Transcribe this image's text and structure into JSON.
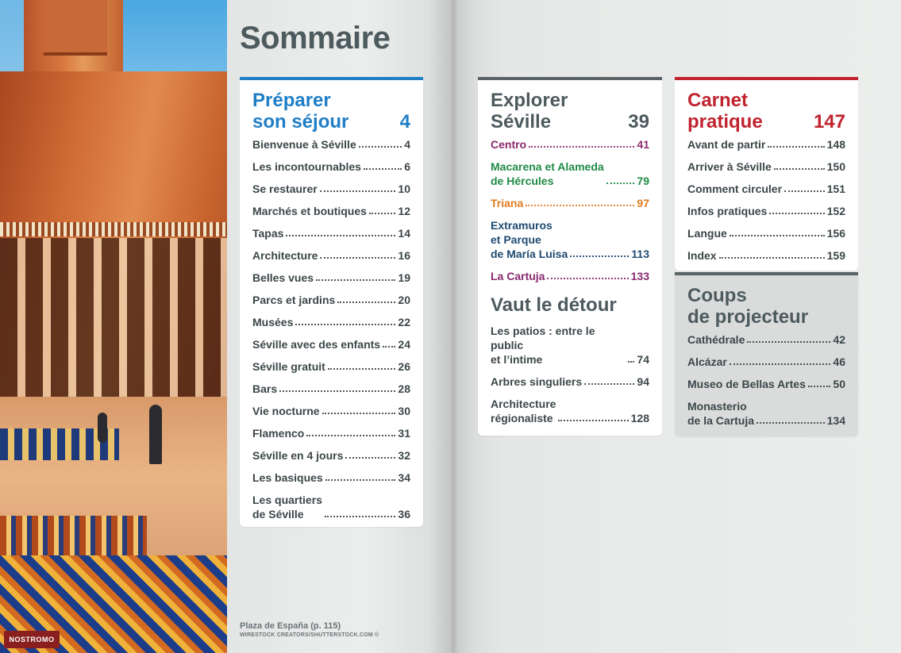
{
  "title": "Sommaire",
  "colors": {
    "blue": "#1f7ec6",
    "gray": "#4d5a5e",
    "red": "#c0232e",
    "purple": "#8a2a6e",
    "green": "#1f8a45",
    "orange": "#e07a1f",
    "navy": "#1f4a72"
  },
  "preparer": {
    "heading": "Préparer\nson séjour",
    "page": "4",
    "entries": [
      {
        "label": "Bienvenue à Séville",
        "page": "4"
      },
      {
        "label": "Les incontournables",
        "page": "6"
      },
      {
        "label": "Se restaurer",
        "page": "10"
      },
      {
        "label": "Marchés et boutiques",
        "page": "12"
      },
      {
        "label": "Tapas",
        "page": "14"
      },
      {
        "label": "Architecture",
        "page": "16"
      },
      {
        "label": "Belles vues",
        "page": "19"
      },
      {
        "label": "Parcs et jardins",
        "page": "20"
      },
      {
        "label": "Musées",
        "page": "22"
      },
      {
        "label": "Séville avec des enfants",
        "page": "24"
      },
      {
        "label": "Séville gratuit",
        "page": "26"
      },
      {
        "label": "Bars",
        "page": "28"
      },
      {
        "label": "Vie nocturne",
        "page": "30"
      },
      {
        "label": "Flamenco",
        "page": "31"
      },
      {
        "label": "Séville en 4 jours",
        "page": "32"
      },
      {
        "label": "Les basiques",
        "page": "34"
      },
      {
        "label": "Les quartiers\nde Séville",
        "page": "36"
      }
    ]
  },
  "explorer": {
    "heading": "Explorer\nSéville",
    "page": "39",
    "entries": [
      {
        "label": "Centro",
        "page": "41",
        "color": "#8a2a6e"
      },
      {
        "label": "Macarena et Alameda\nde Hércules",
        "page": "79",
        "color": "#1f8a45"
      },
      {
        "label": "Triana",
        "page": "97",
        "color": "#e07a1f"
      },
      {
        "label": "Extramuros\net Parque\nde María Luisa",
        "page": "113",
        "color": "#1f4a72"
      },
      {
        "label": "La Cartuja",
        "page": "133",
        "color": "#8a2a6e"
      }
    ]
  },
  "detour": {
    "heading": "Vaut le détour",
    "entries": [
      {
        "label": "Les patios : entre le public\net l’intime",
        "page": "74"
      },
      {
        "label": "Arbres singuliers",
        "page": "94"
      },
      {
        "label": "Architecture\nrégionaliste",
        "page": "128"
      }
    ]
  },
  "carnet": {
    "heading": "Carnet\npratique",
    "page": "147",
    "entries": [
      {
        "label": "Avant de partir",
        "page": "148"
      },
      {
        "label": "Arriver à Séville",
        "page": "150"
      },
      {
        "label": "Comment circuler",
        "page": "151"
      },
      {
        "label": "Infos pratiques",
        "page": "152"
      },
      {
        "label": "Langue",
        "page": "156"
      },
      {
        "label": "Index",
        "page": "159"
      }
    ]
  },
  "coups": {
    "heading": "Coups\nde projecteur",
    "entries": [
      {
        "label": "Cathédrale",
        "page": "42"
      },
      {
        "label": "Alcázar",
        "page": "46"
      },
      {
        "label": "Museo de Bellas Artes",
        "page": "50"
      },
      {
        "label": "Monasterio\nde la Cartuja",
        "page": "134"
      }
    ]
  },
  "caption": "Plaza de España (p. 115)",
  "credit": "WIRESTOCK CREATORS/SHUTTERSTOCK.COM ©",
  "logo": "NOSTROMO"
}
